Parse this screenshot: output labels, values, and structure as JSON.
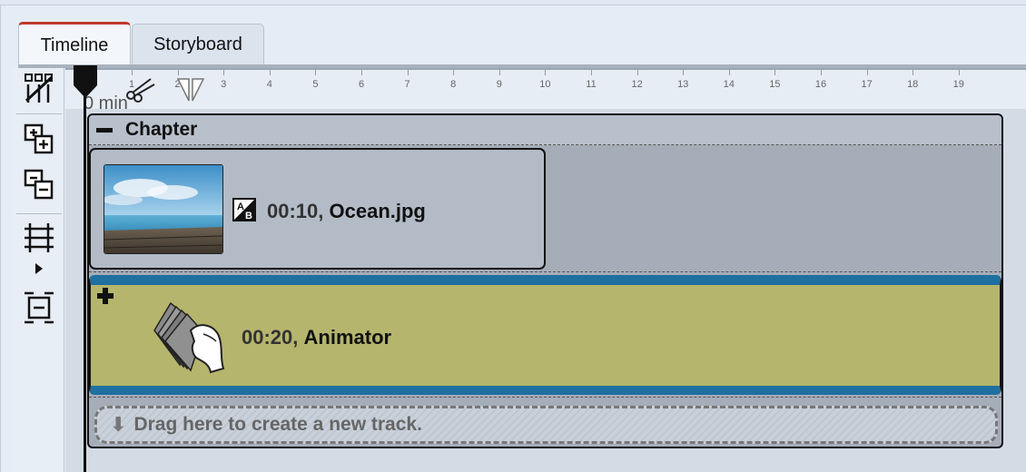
{
  "tabs": [
    {
      "label": "Timeline",
      "active": true
    },
    {
      "label": "Storyboard",
      "active": false
    }
  ],
  "toolbar": {
    "icons": [
      "cut-tracks-icon",
      "add-track-icon",
      "remove-track-icon",
      "fit-tracks-icon",
      "expand-frame-icon"
    ]
  },
  "ruler": {
    "unit_label": "0 min",
    "ticks": [
      "1",
      "2",
      "3",
      "4",
      "5",
      "6",
      "7",
      "8",
      "9",
      "10",
      "11",
      "12",
      "13",
      "14",
      "15",
      "16",
      "17",
      "18",
      "19"
    ]
  },
  "chapter": {
    "title": "Chapter"
  },
  "clips": [
    {
      "duration": "00:10,",
      "name": "Ocean.jpg"
    },
    {
      "duration": "00:20,",
      "name": "Animator"
    }
  ],
  "drop_zone": {
    "text": "Drag here to create a new track."
  },
  "colors": {
    "tab_accent": "#c0392b",
    "animator_bg": "#b5b56d",
    "animator_border": "#1f6fa1"
  }
}
